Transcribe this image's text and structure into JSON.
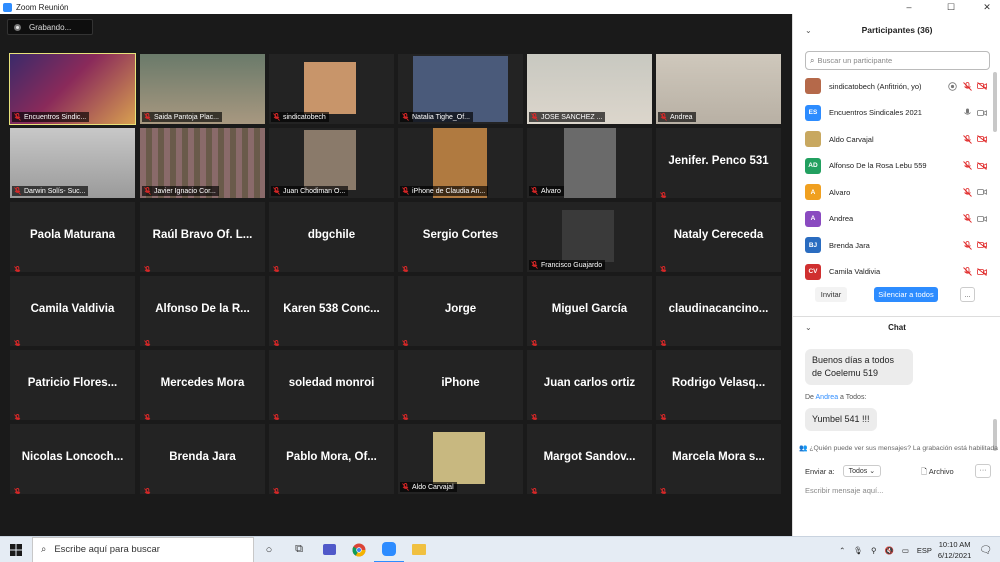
{
  "window": {
    "title": "Zoom Reunión",
    "controls": [
      "–",
      "☐",
      "✕"
    ]
  },
  "recording": {
    "label": "Grabando..."
  },
  "colors": {
    "active_speaker": "#e8e37a",
    "muted_red": "#e02828",
    "zoom_blue": "#2D8CFF",
    "panel_bg": "#ffffff"
  },
  "gallery": {
    "tiles": [
      {
        "caption": "Encuentros Sindic...",
        "kind": "video",
        "active": true
      },
      {
        "caption": "Saida Pantoja Plac...",
        "kind": "video"
      },
      {
        "caption": "sindicatobech",
        "kind": "video"
      },
      {
        "caption": "Natalia Tighe_Of...",
        "kind": "video"
      },
      {
        "caption": "JOSE SANCHEZ ...",
        "kind": "video"
      },
      {
        "caption": "Andrea",
        "kind": "video"
      },
      {
        "caption": "Darwin Solís- Suc...",
        "kind": "video"
      },
      {
        "caption": "Javier Ignacio Cor...",
        "kind": "video"
      },
      {
        "caption": "Juan Chodiman O...",
        "kind": "video"
      },
      {
        "caption": "iPhone de Claudia An...",
        "kind": "video"
      },
      {
        "caption": "Alvaro",
        "kind": "video"
      },
      {
        "name": "Jenifer. Penco 531",
        "kind": "name"
      },
      {
        "name": "Paola Maturana",
        "kind": "name"
      },
      {
        "name": "Raúl Bravo Of. L...",
        "kind": "name"
      },
      {
        "name": "dbgchile",
        "kind": "name"
      },
      {
        "name": "Sergio Cortes",
        "kind": "name"
      },
      {
        "caption": "Francisco Guajardo",
        "kind": "video"
      },
      {
        "name": "Nataly Cereceda",
        "kind": "name"
      },
      {
        "name": "Camila Valdivia",
        "kind": "name"
      },
      {
        "name": "Alfonso De la R...",
        "kind": "name"
      },
      {
        "name": "Karen 538 Conc...",
        "kind": "name"
      },
      {
        "name": "Jorge",
        "kind": "name"
      },
      {
        "name": "Miguel García",
        "kind": "name"
      },
      {
        "name": "claudinacancino...",
        "kind": "name"
      },
      {
        "name": "Patricio Flores...",
        "kind": "name"
      },
      {
        "name": "Mercedes Mora",
        "kind": "name"
      },
      {
        "name": "soledad monroi",
        "kind": "name"
      },
      {
        "name": "iPhone",
        "kind": "name"
      },
      {
        "name": "Juan carlos ortiz",
        "kind": "name"
      },
      {
        "name": "Rodrigo Velasq...",
        "kind": "name"
      },
      {
        "name": "Nicolas Loncoch...",
        "kind": "name"
      },
      {
        "name": "Brenda Jara",
        "kind": "name"
      },
      {
        "name": "Pablo Mora, Of...",
        "kind": "name"
      },
      {
        "caption": "Aldo Carvajal",
        "kind": "video"
      },
      {
        "name": "Margot Sandov...",
        "kind": "name"
      },
      {
        "name": "Marcela Mora s...",
        "kind": "name"
      }
    ]
  },
  "participants": {
    "title": "Participantes (36)",
    "search_placeholder": "Buscar un participante",
    "list": [
      {
        "name": "sindicatobech (Anfitrión, yo)",
        "initials": "",
        "color": "#b5694a"
      },
      {
        "name": "Encuentros Sindicales 2021",
        "initials": "ES",
        "color": "#2D8CFF"
      },
      {
        "name": "Aldo Carvajal",
        "initials": "",
        "color": "#c8a860"
      },
      {
        "name": "Alfonso De la Rosa Lebu 559",
        "initials": "AD",
        "color": "#22a060"
      },
      {
        "name": "Alvaro",
        "initials": "A",
        "color": "#f0a020"
      },
      {
        "name": "Andrea",
        "initials": "A",
        "color": "#8a4ac0"
      },
      {
        "name": "Brenda Jara",
        "initials": "BJ",
        "color": "#2a6cc0"
      },
      {
        "name": "Camila Valdivia",
        "initials": "CV",
        "color": "#d03030"
      }
    ],
    "invite_label": "Invitar",
    "mute_all_label": "Silenciar a todos",
    "more_label": "..."
  },
  "chat": {
    "title": "Chat",
    "messages": [
      {
        "from": "",
        "text": "Buenos días a todos de Coelemu 519"
      },
      {
        "from_prefix": "De",
        "from": "Andrea",
        "to": "a Todos:",
        "text": "Yumbel 541 !!!"
      }
    ],
    "notice": "¿Quién puede ver sus mensajes? La grabación está habilitada",
    "send_to_label": "Enviar a:",
    "send_to_value": "Todos",
    "file_label": "Archivo",
    "input_placeholder": "Escribir mensaje aquí..."
  },
  "taskbar": {
    "search_placeholder": "Escribe aquí para buscar",
    "language": "ESP",
    "time": "10:10 AM",
    "date": "6/12/2021"
  }
}
